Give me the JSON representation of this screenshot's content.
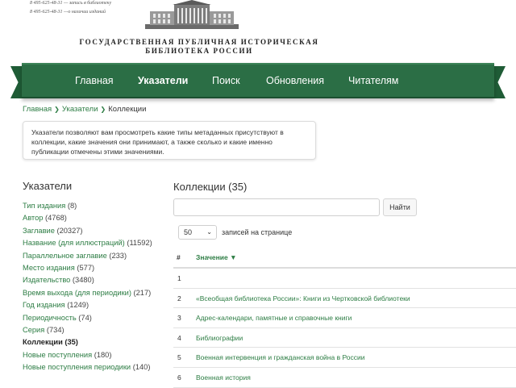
{
  "header": {
    "phone_line_1": "8 495-625-48-31 — запись в библиотеку",
    "phone_line_2": "8 495-625-48-31 —о наличии изданий",
    "library_name_line_1": "ГОСУДАРСТВЕННАЯ ПУБЛИЧНАЯ ИСТОРИЧЕСКАЯ",
    "library_name_line_2": "БИБЛИОТЕКА РОССИИ"
  },
  "nav": {
    "items": [
      {
        "label": "Главная"
      },
      {
        "label": "Указатели"
      },
      {
        "label": "Поиск"
      },
      {
        "label": "Обновления"
      },
      {
        "label": "Читателям"
      }
    ],
    "active": "Указатели",
    "color": "#2b6e45"
  },
  "breadcrumb": {
    "items": [
      "Главная",
      "Указатели"
    ],
    "current": "Коллекции"
  },
  "info_text": "Указатели позволяют вам просмотреть какие типы метаданных присутствуют в коллекции, какие значения они принимают, а также сколько и какие именно публикации отмечены этими значениями.",
  "sidebar": {
    "title": "Указатели",
    "items": [
      {
        "label": "Тип издания",
        "count": "(8)"
      },
      {
        "label": "Автор",
        "count": "(4768)"
      },
      {
        "label": "Заглавие",
        "count": "(20327)"
      },
      {
        "label": "Название (для иллюстраций)",
        "count": "(11592)"
      },
      {
        "label": "Параллельное заглавие",
        "count": "(233)"
      },
      {
        "label": "Место издания",
        "count": "(577)"
      },
      {
        "label": "Издательство",
        "count": "(3480)"
      },
      {
        "label": "Время выхода (для периодики)",
        "count": "(217)"
      },
      {
        "label": "Год издания",
        "count": "(1249)"
      },
      {
        "label": "Периодичность",
        "count": "(74)"
      },
      {
        "label": "Серия",
        "count": "(734)"
      },
      {
        "label": "Коллекции",
        "count": "(35)"
      },
      {
        "label": "Новые поступления",
        "count": "(180)"
      },
      {
        "label": "Новые поступления периодики",
        "count": "(140)"
      }
    ],
    "active_index": 11
  },
  "main": {
    "title": "Коллекции (35)",
    "search": {
      "value": "",
      "placeholder": "",
      "button": "Найти"
    },
    "per_page": {
      "value": "50",
      "label": "записей на странице"
    },
    "table": {
      "headers": {
        "num": "#",
        "value": "Значение ▼"
      },
      "rows": [
        {
          "num": "1",
          "value": ""
        },
        {
          "num": "2",
          "value": "«Всеобщая библиотека России»: Книги из Чертковской библиотеки"
        },
        {
          "num": "3",
          "value": "Адрес-календари, памятные и справочные книги"
        },
        {
          "num": "4",
          "value": "Библиографии"
        },
        {
          "num": "5",
          "value": "Военная интервенция и гражданская война в России"
        },
        {
          "num": "6",
          "value": "Военная история"
        }
      ]
    }
  },
  "colors": {
    "link": "#2d7d44",
    "nav": "#2b6e45",
    "text": "#333333"
  }
}
